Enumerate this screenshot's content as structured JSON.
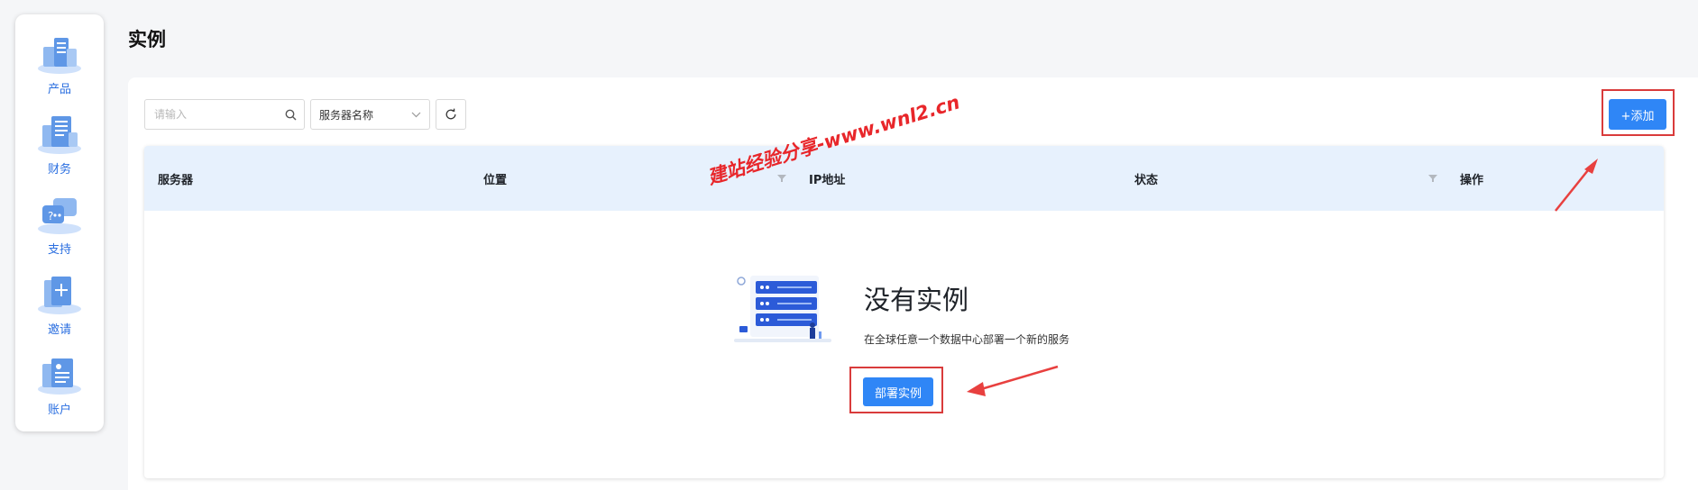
{
  "sidebar": {
    "items": [
      {
        "label": "产品",
        "icon": "products-icon"
      },
      {
        "label": "财务",
        "icon": "finance-icon"
      },
      {
        "label": "支持",
        "icon": "support-icon"
      },
      {
        "label": "邀请",
        "icon": "invite-icon"
      },
      {
        "label": "账户",
        "icon": "account-icon"
      }
    ]
  },
  "page": {
    "title": "实例"
  },
  "toolbar": {
    "search_placeholder": "请输入",
    "search_value": "",
    "select_value": "服务器名称",
    "add_label": "+添加"
  },
  "table": {
    "columns": [
      "服务器",
      "位置",
      "IP地址",
      "状态",
      "操作"
    ],
    "rows": []
  },
  "empty": {
    "title": "没有实例",
    "description": "在全球任意一个数据中心部署一个新的服务",
    "deploy_label": "部署实例"
  },
  "watermark": "建站经验分享-www.wnl2.cn",
  "colors": {
    "accent": "#2f86f6",
    "header_bg": "#e7f1fd",
    "annotation_red": "#d93b3b"
  }
}
